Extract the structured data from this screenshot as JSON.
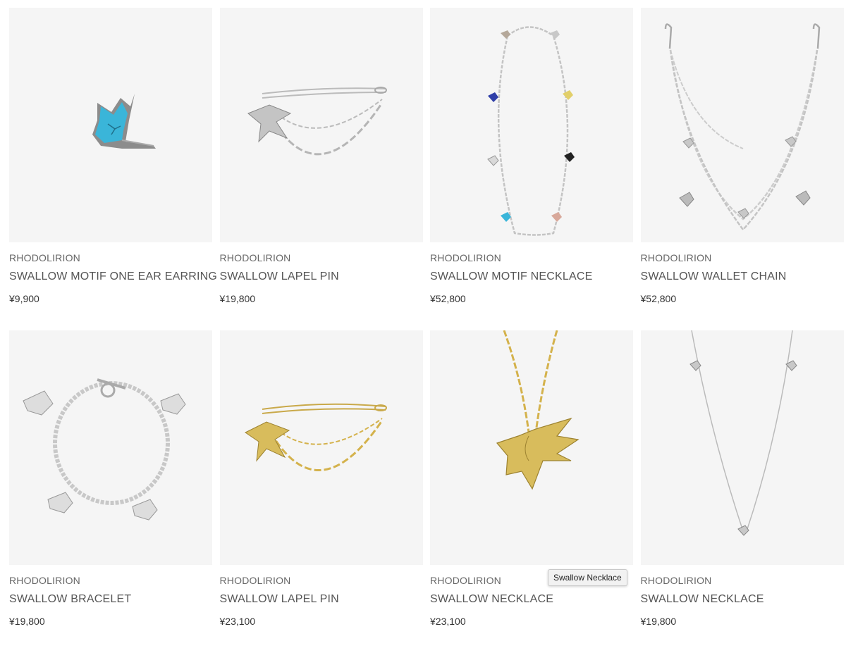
{
  "products": [
    {
      "brand": "RHODOLIRION",
      "name": "SWALLOW MOTIF ONE EAR EARRING",
      "price": "¥9,900",
      "image": "turquoise-swallow-earring"
    },
    {
      "brand": "RHODOLIRION",
      "name": "SWALLOW LAPEL PIN",
      "price": "¥19,800",
      "image": "silver-swallow-lapel-pin"
    },
    {
      "brand": "RHODOLIRION",
      "name": "SWALLOW MOTIF NECKLACE",
      "price": "¥52,800",
      "image": "multicolor-swallow-necklace"
    },
    {
      "brand": "RHODOLIRION",
      "name": "SWALLOW WALLET CHAIN",
      "price": "¥52,800",
      "image": "silver-swallow-wallet-chain"
    },
    {
      "brand": "RHODOLIRION",
      "name": "SWALLOW BRACELET",
      "price": "¥19,800",
      "image": "silver-swallow-charm-bracelet"
    },
    {
      "brand": "RHODOLIRION",
      "name": "SWALLOW LAPEL PIN",
      "price": "¥23,100",
      "image": "gold-swallow-lapel-pin"
    },
    {
      "brand": "RHODOLIRION",
      "name": "SWALLOW NECKLACE",
      "price": "¥23,100",
      "image": "gold-swallow-pendant-necklace"
    },
    {
      "brand": "RHODOLIRION",
      "name": "SWALLOW NECKLACE",
      "price": "¥19,800",
      "image": "silver-swallow-fine-necklace"
    }
  ],
  "tooltip": {
    "text": "Swallow Necklace"
  },
  "colors": {
    "thumb_background": "#f5f5f5",
    "silver": "#c8c8c8",
    "gold": "#d4b24c",
    "turquoise": "#3ab5d9"
  }
}
